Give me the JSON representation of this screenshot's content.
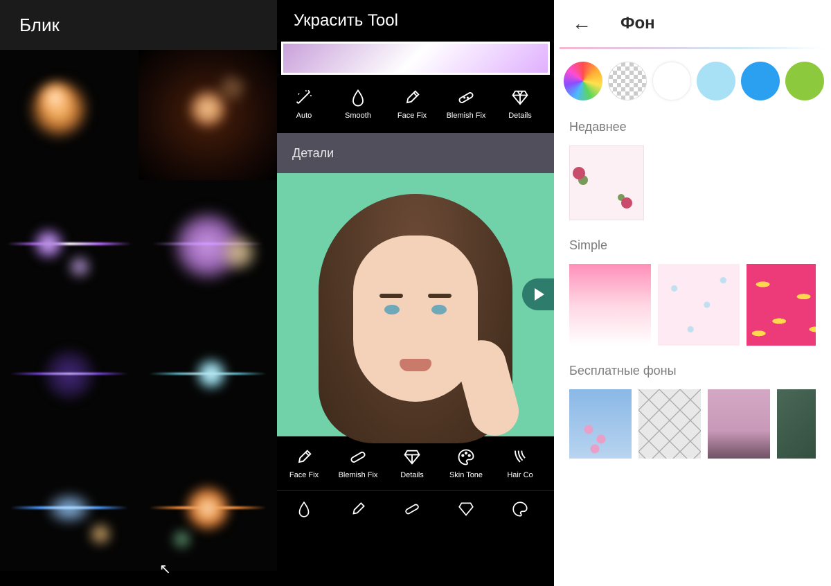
{
  "panel1": {
    "title": "Блик"
  },
  "panel2": {
    "title": "Украсить Tool",
    "tools_top": [
      {
        "icon": "wand",
        "label": "Auto"
      },
      {
        "icon": "drop",
        "label": "Smooth"
      },
      {
        "icon": "brush",
        "label": "Face Fix"
      },
      {
        "icon": "bandage",
        "label": "Blemish Fix"
      },
      {
        "icon": "diamond",
        "label": "Details"
      }
    ],
    "section_title": "Детали",
    "tools_bottom": [
      {
        "icon": "brush",
        "label": "Face Fix"
      },
      {
        "icon": "bandage",
        "label": "Blemish Fix"
      },
      {
        "icon": "diamond",
        "label": "Details"
      },
      {
        "icon": "palette",
        "label": "Skin Tone"
      },
      {
        "icon": "hair",
        "label": "Hair Co"
      }
    ],
    "tools_row3_icons": [
      "drop",
      "brush",
      "bandage",
      "diamond",
      "palette"
    ]
  },
  "panel3": {
    "title": "Фон",
    "color_swatches": [
      "rainbow",
      "transparent",
      "#ffffff",
      "#a8e0f5",
      "#2b9ff0",
      "#8cc93d"
    ],
    "section_recent": "Недавнее",
    "section_simple": "Simple",
    "section_free": "Бесплатные фоны"
  }
}
